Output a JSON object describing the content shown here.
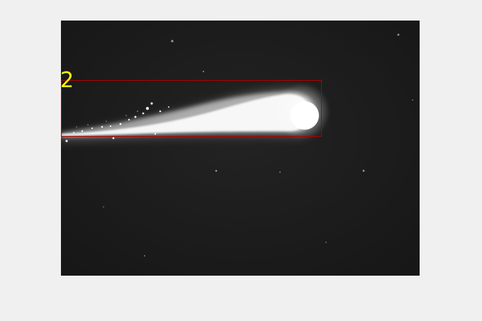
{
  "detections": [
    {
      "label": "2",
      "box_color": "#b00000",
      "label_color": "#ffff00"
    }
  ],
  "colors": {
    "figure_background": "#f0f0f0",
    "sky": "#1c1c1c",
    "meteor": "#ffffff"
  }
}
